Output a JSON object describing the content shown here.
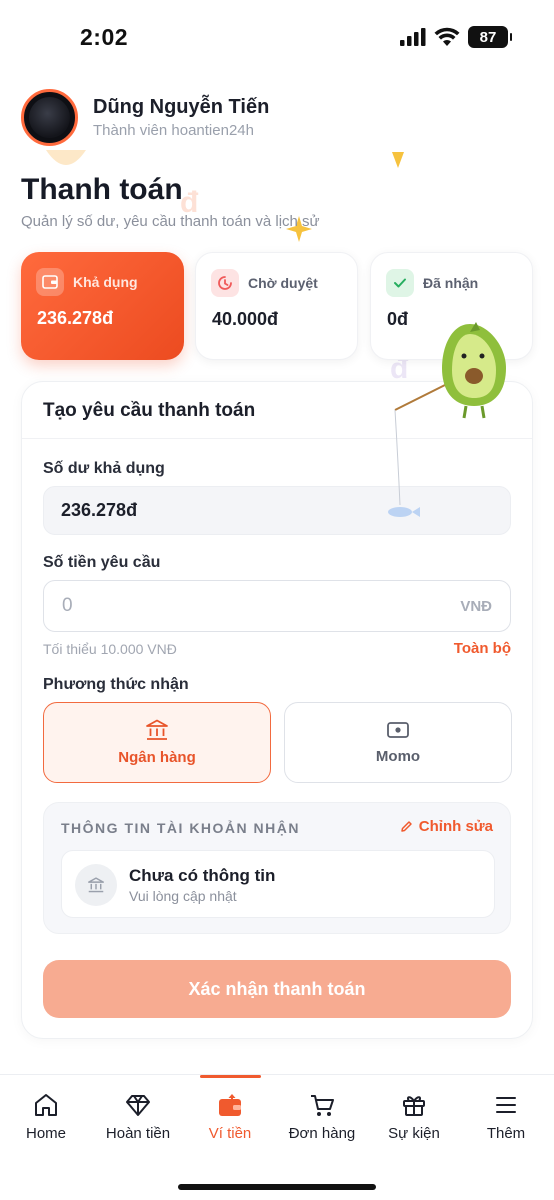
{
  "status_bar": {
    "time": "2:02",
    "battery": "87"
  },
  "profile": {
    "name": "Dũng Nguyễn Tiến",
    "subtitle": "Thành viên hoantien24h"
  },
  "page": {
    "title": "Thanh toán",
    "subtitle": "Quản lý số dư, yêu cầu thanh toán và lịch sử"
  },
  "cards": [
    {
      "label": "Khả dụng",
      "value": "236.278đ",
      "icon": "wallet-icon",
      "accent": "#ffffff"
    },
    {
      "label": "Chờ duyệt",
      "value": "40.000đ",
      "icon": "clock-icon",
      "accent": "#f05a5a"
    },
    {
      "label": "Đã nhận",
      "value": "0đ",
      "icon": "check-icon",
      "accent": "#27ae60"
    }
  ],
  "form": {
    "title": "Tạo yêu cầu thanh toán",
    "available_label": "Số dư khả dụng",
    "available_value": "236.278đ",
    "amount_label": "Số tiền yêu cầu",
    "amount_placeholder": "0",
    "amount_value": "",
    "amount_unit": "VNĐ",
    "min_hint": "Tối thiểu 10.000 VNĐ",
    "all_link": "Toàn bộ",
    "method_label": "Phương thức nhận",
    "methods": [
      {
        "label": "Ngân hàng",
        "icon": "bank-icon",
        "selected": true
      },
      {
        "label": "Momo",
        "icon": "momo-wallet-icon",
        "selected": false
      }
    ],
    "account_section_title": "THÔNG TIN TÀI KHOẢN NHẬN",
    "edit_label": "Chỉnh sửa",
    "account_title": "Chưa có thông tin",
    "account_subtitle": "Vui lòng cập nhật",
    "confirm_label": "Xác nhận thanh toán"
  },
  "bottom_nav": [
    {
      "label": "Home",
      "icon": "home-icon",
      "active": false
    },
    {
      "label": "Hoàn tiền",
      "icon": "diamond-icon",
      "active": false
    },
    {
      "label": "Ví tiền",
      "icon": "wallet-icon",
      "active": true
    },
    {
      "label": "Đơn hàng",
      "icon": "cart-icon",
      "active": false
    },
    {
      "label": "Sự kiện",
      "icon": "gift-icon",
      "active": false
    },
    {
      "label": "Thêm",
      "icon": "menu-icon",
      "active": false
    }
  ],
  "colors": {
    "primary": "#f05a2e",
    "primary_light": "#fff3ee",
    "button_disabled": "#f7ab91"
  }
}
